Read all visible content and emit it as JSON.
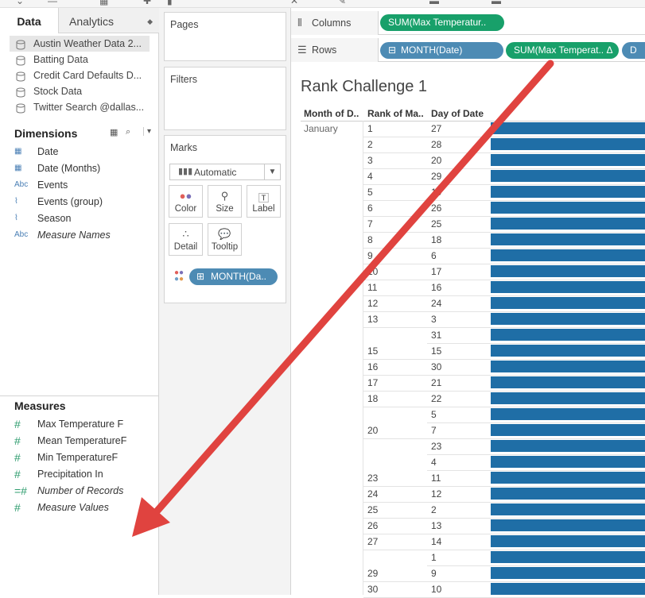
{
  "toolbar": {
    "icons": [
      "undo-icon",
      "redo-icon",
      "add-datasource-icon",
      "swap-icon",
      "sort-icon",
      "clear-icon",
      "highlight-icon",
      "group-icon",
      "label-icon"
    ]
  },
  "data_pane": {
    "tabs": {
      "data": "Data",
      "analytics": "Analytics"
    },
    "datasources": [
      {
        "label": "Austin Weather Data 2...",
        "selected": true
      },
      {
        "label": "Batting Data",
        "selected": false
      },
      {
        "label": "Credit Card Defaults D...",
        "selected": false
      },
      {
        "label": "Stock Data",
        "selected": false
      },
      {
        "label": "Twitter Search @dallas...",
        "selected": false
      }
    ],
    "dimensions_title": "Dimensions",
    "dimensions": [
      {
        "icon": "calendar-icon",
        "glyph": "▦",
        "label": "Date",
        "italic": false
      },
      {
        "icon": "calendar-discrete-icon",
        "glyph": "▦",
        "label": "Date (Months)",
        "italic": false
      },
      {
        "icon": "string-icon",
        "glyph": "Abc",
        "label": "Events",
        "italic": false
      },
      {
        "icon": "paperclip-icon",
        "glyph": "⌇",
        "label": "Events (group)",
        "italic": false
      },
      {
        "icon": "paperclip-icon",
        "glyph": "⌇",
        "label": "Season",
        "italic": false
      },
      {
        "icon": "string-icon",
        "glyph": "Abc",
        "label": "Measure Names",
        "italic": true
      }
    ],
    "measures_title": "Measures",
    "measures": [
      {
        "icon": "number-icon",
        "glyph": "#",
        "label": "Max Temperature F",
        "italic": false
      },
      {
        "icon": "number-icon",
        "glyph": "#",
        "label": "Mean TemperatureF",
        "italic": false
      },
      {
        "icon": "number-icon",
        "glyph": "#",
        "label": "Min TemperatureF",
        "italic": false
      },
      {
        "icon": "number-icon",
        "glyph": "#",
        "label": "Precipitation In",
        "italic": false
      },
      {
        "icon": "number-calc-icon",
        "glyph": "=#",
        "label": "Number of Records",
        "italic": true
      },
      {
        "icon": "number-icon",
        "glyph": "#",
        "label": "Measure Values",
        "italic": true
      }
    ]
  },
  "cards": {
    "pages": "Pages",
    "filters": "Filters",
    "marks": "Marks",
    "mark_type": "Automatic",
    "buttons": [
      "Color",
      "Size",
      "Label",
      "Detail",
      "Tooltip"
    ],
    "marks_pill": "MONTH(Da.."
  },
  "shelves": {
    "columns_label": "Columns",
    "rows_label": "Rows",
    "columns_pill": "SUM(Max Temperatur..",
    "rows_pills": [
      "MONTH(Date)",
      "SUM(Max Temperat.. Δ",
      "D"
    ]
  },
  "view": {
    "title": "Rank Challenge 1",
    "headers": [
      "Month of D..",
      "Rank of Ma..",
      "Day of Date"
    ],
    "month": "January",
    "rows": [
      {
        "rank": "1",
        "day": "27"
      },
      {
        "rank": "2",
        "day": "28"
      },
      {
        "rank": "3",
        "day": "20"
      },
      {
        "rank": "4",
        "day": "29"
      },
      {
        "rank": "5",
        "day": "19"
      },
      {
        "rank": "6",
        "day": "26"
      },
      {
        "rank": "7",
        "day": "25"
      },
      {
        "rank": "8",
        "day": "18"
      },
      {
        "rank": "9",
        "day": "6"
      },
      {
        "rank": "10",
        "day": "17"
      },
      {
        "rank": "11",
        "day": "16"
      },
      {
        "rank": "12",
        "day": "24"
      },
      {
        "rank": "13",
        "day": "3"
      },
      {
        "rank": "",
        "day": "31"
      },
      {
        "rank": "15",
        "day": "15"
      },
      {
        "rank": "16",
        "day": "30"
      },
      {
        "rank": "17",
        "day": "21"
      },
      {
        "rank": "18",
        "day": "22"
      },
      {
        "rank": "",
        "day": "5"
      },
      {
        "rank": "20",
        "day": "7"
      },
      {
        "rank": "",
        "day": "23"
      },
      {
        "rank": "",
        "day": "4"
      },
      {
        "rank": "23",
        "day": "11"
      },
      {
        "rank": "24",
        "day": "12"
      },
      {
        "rank": "25",
        "day": "2"
      },
      {
        "rank": "26",
        "day": "13"
      },
      {
        "rank": "27",
        "day": "14"
      },
      {
        "rank": "",
        "day": "1"
      },
      {
        "rank": "29",
        "day": "9"
      },
      {
        "rank": "30",
        "day": "10"
      }
    ]
  },
  "colors": {
    "bar": "#1f6ea6",
    "pill_blue": "#4d8bb4",
    "pill_green": "#18a06a",
    "arrow": "#e0433f"
  }
}
